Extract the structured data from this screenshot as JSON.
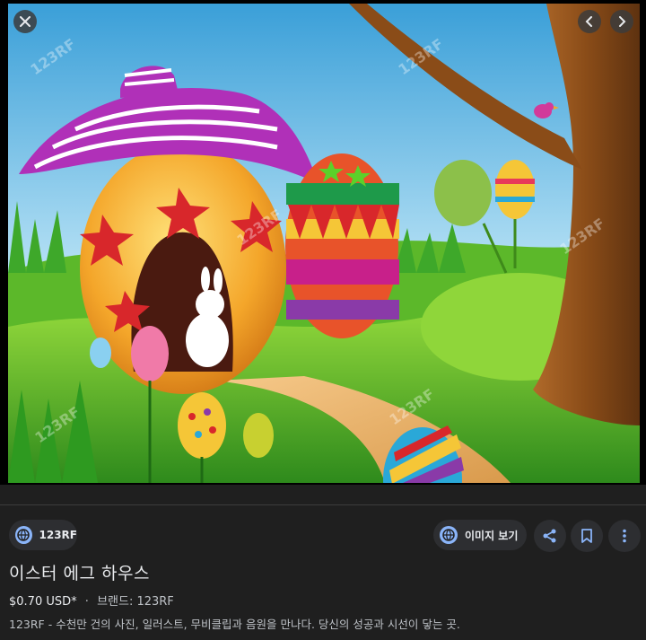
{
  "viewer": {
    "image_alt": "이스터 에그 하우스",
    "watermark": "123RF",
    "close_icon": "close-icon",
    "prev_icon": "chevron-left-icon",
    "next_icon": "chevron-right-icon"
  },
  "source": {
    "name": "123RF",
    "icon": "globe-icon"
  },
  "actions": {
    "view_image_label": "이미지 보기",
    "share_icon": "share-icon",
    "save_icon": "bookmark-icon",
    "more_icon": "more-vert-icon"
  },
  "details": {
    "title": "이스터 에그 하우스",
    "price": "$0.70 USD*",
    "separator": "·",
    "brand": "브랜드: 123RF",
    "description": "123RF - 수천만 건의 사진, 일러스트, 무비클립과 음원을 만나다. 당신의 성공과 시선이 닿는 곳."
  },
  "colors": {
    "background": "#1f1f1f",
    "chip": "#2d2e31",
    "accent": "#8ab4f8"
  }
}
